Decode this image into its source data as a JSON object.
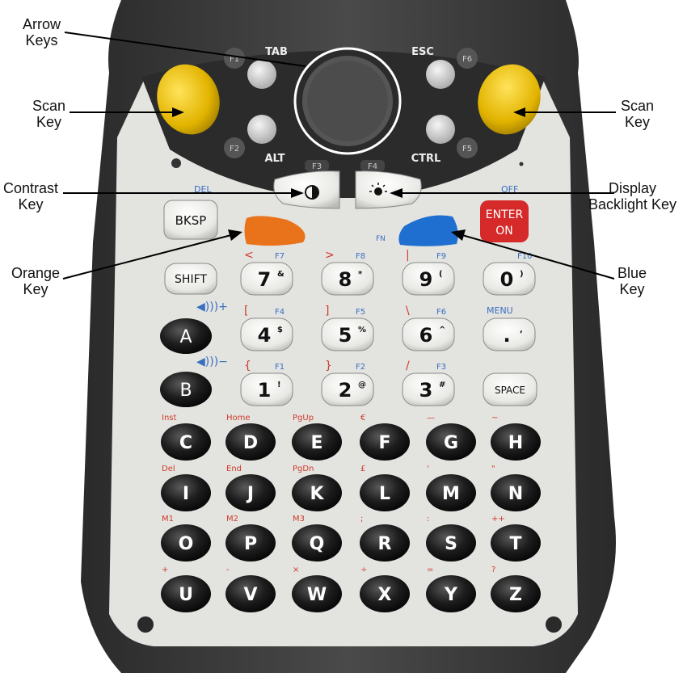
{
  "callouts": {
    "arrow_keys": [
      "Arrow",
      "Keys"
    ],
    "scan_key_left": [
      "Scan",
      "Key"
    ],
    "scan_key_right": [
      "Scan",
      "Key"
    ],
    "contrast_key": [
      "Contrast",
      "Key"
    ],
    "display_backlight_key": [
      "Display",
      "Backlight Key"
    ],
    "orange_key": [
      "Orange",
      "Key"
    ],
    "blue_key": [
      "Blue",
      "Key"
    ]
  },
  "keys": {
    "top_small": {
      "f1": "F1",
      "tab": "TAB",
      "f2": "F2",
      "alt": "ALT",
      "esc": "ESC",
      "f6": "F6",
      "ctrl": "CTRL",
      "f5": "F5",
      "f3": "F3",
      "f4": "F4"
    },
    "del_label": "DEL",
    "off_label": "OFF",
    "fn_label": "FN",
    "bksp": "BKSP",
    "enter": [
      "ENTER",
      "ON"
    ],
    "shift": "SHIFT",
    "space": "SPACE",
    "menu": "MENU",
    "num_row1": [
      {
        "main": "7",
        "sup": "&",
        "alt": "<",
        "fn": "F7"
      },
      {
        "main": "8",
        "sup": "*",
        "alt": ">",
        "fn": "F8"
      },
      {
        "main": "9",
        "sup": "(",
        "alt": "|",
        "fn": "F9"
      },
      {
        "main": "0",
        "sup": ")",
        "alt": "",
        "fn": "F10"
      }
    ],
    "num_row2": [
      {
        "main": "4",
        "sup": "$",
        "alt": "[",
        "fn": "F4"
      },
      {
        "main": "5",
        "sup": "%",
        "alt": "]",
        "fn": "F5"
      },
      {
        "main": "6",
        "sup": "^",
        "alt": "\\",
        "fn": "F6"
      },
      {
        "main": ".",
        "sup": ",",
        "alt": "",
        "fn": ""
      }
    ],
    "num_row3": [
      {
        "main": "1",
        "sup": "!",
        "alt": "{",
        "fn": "F1"
      },
      {
        "main": "2",
        "sup": "@",
        "alt": "}",
        "fn": "F2"
      },
      {
        "main": "3",
        "sup": "#",
        "alt": "/",
        "fn": "F3"
      }
    ],
    "volume_a": "A",
    "volume_b": "B",
    "alpha_rows": [
      {
        "letters": [
          "C",
          "D",
          "E",
          "F",
          "G",
          "H"
        ],
        "labels": [
          "Inst",
          "Home",
          "PgUp",
          "€",
          "—",
          "~"
        ]
      },
      {
        "letters": [
          "I",
          "J",
          "K",
          "L",
          "M",
          "N"
        ],
        "labels": [
          "Del",
          "End",
          "PgDn",
          "£",
          "'",
          "\""
        ]
      },
      {
        "letters": [
          "O",
          "P",
          "Q",
          "R",
          "S",
          "T"
        ],
        "labels": [
          "M1",
          "M2",
          "M3",
          ";",
          ":",
          "++"
        ]
      },
      {
        "letters": [
          "U",
          "V",
          "W",
          "X",
          "Y",
          "Z"
        ],
        "labels": [
          "+",
          "-",
          "×",
          "÷",
          "=",
          "?"
        ]
      }
    ]
  },
  "colors": {
    "scan": "#e2b400",
    "orange": "#e8731a",
    "blue": "#1e6fd0",
    "enter": "#d62a2a",
    "alt_label": "#d03a2a",
    "fn_label": "#3a6fc0",
    "black_key": "#1a1a1a",
    "white_key": "#f2f2ee"
  }
}
